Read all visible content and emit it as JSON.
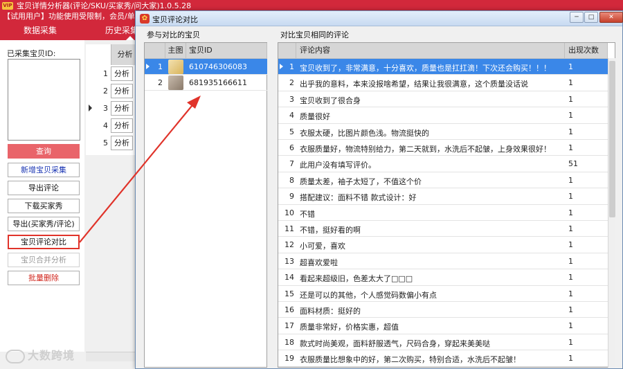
{
  "main": {
    "vip_badge": "VIP",
    "title": "宝贝详情分析器(评论/SKU/买家秀/问大家)1.0.5.28",
    "notice": "【试用用户】功能使用受限制，会员/单独购买",
    "tabs": [
      "数据采集",
      "历史采集"
    ],
    "ids_label": "已采集宝贝ID:",
    "buttons": {
      "query": "查询",
      "new_collect": "新增宝贝采集",
      "export_comments": "导出评论",
      "download_buyer_show": "下载买家秀",
      "export_both": "导出(买家秀/评论)",
      "compare": "宝贝评论对比",
      "merge": "宝贝合并分析",
      "batch_delete": "批量删除"
    },
    "history": {
      "header": "分析",
      "rows": [
        {
          "num": "1",
          "btn": "分析"
        },
        {
          "num": "2",
          "btn": "分析"
        },
        {
          "num": "3",
          "btn": "分析"
        },
        {
          "num": "4",
          "btn": "分析"
        },
        {
          "num": "5",
          "btn": "分析"
        }
      ]
    },
    "watermark": "大数跨境"
  },
  "dialog": {
    "title": "宝贝评论对比",
    "icon": "app-icon",
    "items_label": "参与对比的宝贝",
    "comments_label": "对比宝贝相同的评论",
    "items_columns": [
      "主图",
      "宝贝ID"
    ],
    "items": [
      {
        "num": "1",
        "id": "610746306083",
        "thumb_color": "#d8b35a"
      },
      {
        "num": "2",
        "id": "681935166611",
        "thumb_color": "#8a7a6a"
      }
    ],
    "comment_columns": [
      "评论内容",
      "出现次数"
    ],
    "comments": [
      {
        "num": "1",
        "text": "宝贝收到了，非常满意，十分喜欢，质量也是扛扛滴！下次还会购买！！！",
        "count": "1"
      },
      {
        "num": "2",
        "text": "出乎我的意料，本来没报啥希望，结果让我很满意，这个质量没话说",
        "count": "1"
      },
      {
        "num": "3",
        "text": "宝贝收到了很合身",
        "count": "1"
      },
      {
        "num": "4",
        "text": "质量很好",
        "count": "1"
      },
      {
        "num": "5",
        "text": "衣服太硬，比图片颜色浅。物流挺快的",
        "count": "1"
      },
      {
        "num": "6",
        "text": "衣服质量好，物流特别给力，第二天就到，水洗后不起皱，上身效果很好！",
        "count": "1"
      },
      {
        "num": "7",
        "text": "此用户没有填写评价。",
        "count": "51"
      },
      {
        "num": "8",
        "text": "质量太差，袖子太短了，不值这个价",
        "count": "1"
      },
      {
        "num": "9",
        "text": "搭配建议：面料不错 款式设计：好",
        "count": "1"
      },
      {
        "num": "10",
        "text": "不错",
        "count": "1"
      },
      {
        "num": "11",
        "text": "不错，挺好看的啊",
        "count": "1"
      },
      {
        "num": "12",
        "text": "小可爱，喜欢",
        "count": "1"
      },
      {
        "num": "13",
        "text": "超喜欢爱啦",
        "count": "1"
      },
      {
        "num": "14",
        "text": "看起来超级旧，色差太大了□□□",
        "count": "1"
      },
      {
        "num": "15",
        "text": "还是可以的其他，个人感觉码数偏小有点",
        "count": "1"
      },
      {
        "num": "16",
        "text": "面料材质：挺好的",
        "count": "1"
      },
      {
        "num": "17",
        "text": "质量非常好，价格实惠，超值",
        "count": "1"
      },
      {
        "num": "18",
        "text": "款式时尚美观，面料舒服透气，尺码合身，穿起来美美哒",
        "count": "1"
      },
      {
        "num": "19",
        "text": "衣服质量比想象中的好，第二次购买，特别合适，水洗后不起皱！",
        "count": "1"
      }
    ],
    "window_buttons": {
      "minimize": "─",
      "maximize": "□",
      "close": "✕"
    }
  },
  "colors": {
    "brand_red": "#d2283b",
    "selection_blue": "#3a87e8",
    "annotation_red": "#e0332a"
  }
}
